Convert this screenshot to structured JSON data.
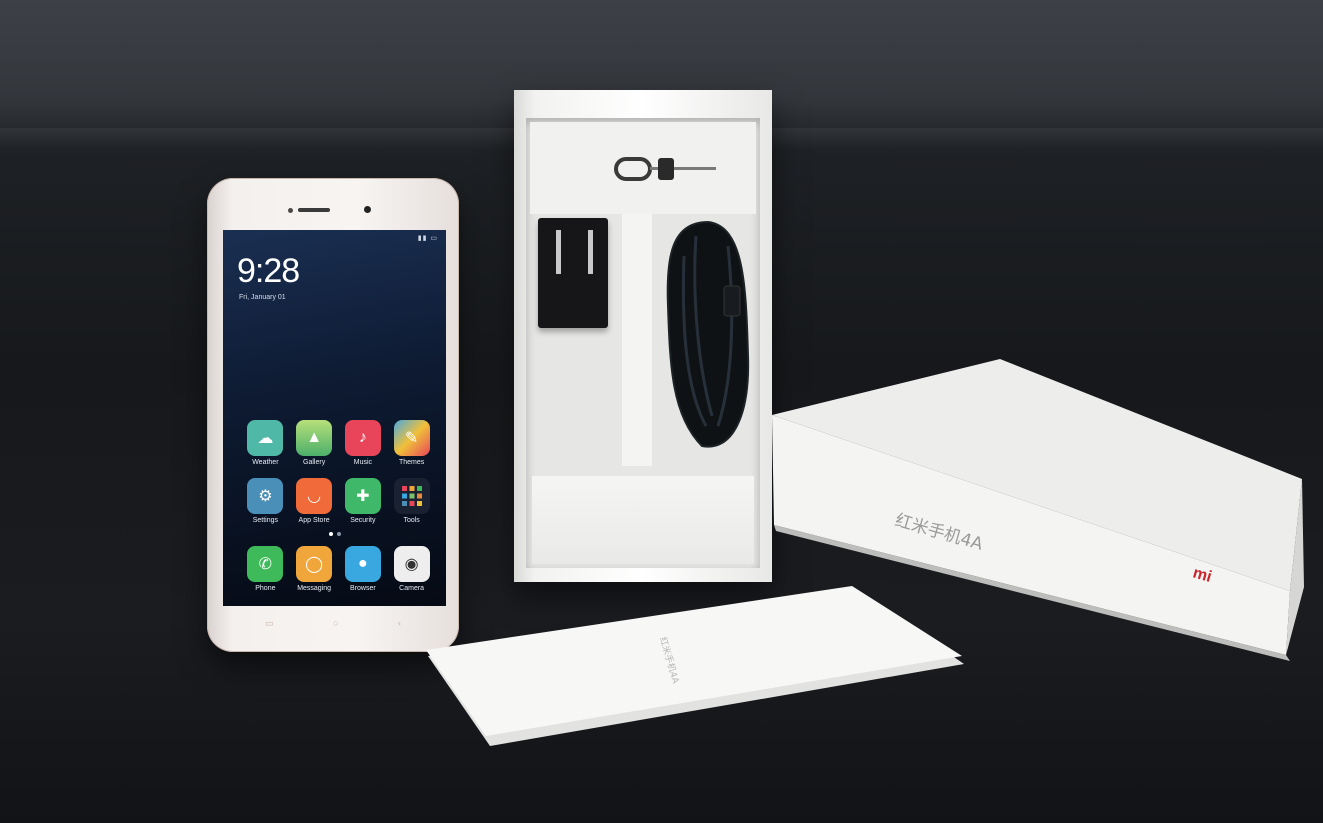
{
  "phone": {
    "clock": "9:28",
    "date": "Fri, January 01",
    "apps": [
      {
        "label": "Weather",
        "icon": "weather-icon",
        "color": "#4fb8a6"
      },
      {
        "label": "Gallery",
        "icon": "gallery-icon",
        "color": "#7cc46a"
      },
      {
        "label": "Music",
        "icon": "music-icon",
        "color": "#e8455a"
      },
      {
        "label": "Themes",
        "icon": "themes-icon",
        "color": "#e98a3a"
      },
      {
        "label": "Settings",
        "icon": "settings-icon",
        "color": "#4a8fb8"
      },
      {
        "label": "App Store",
        "icon": "app-store-icon",
        "color": "#f06a3a"
      },
      {
        "label": "Security",
        "icon": "security-icon",
        "color": "#3fb86a"
      },
      {
        "label": "Tools",
        "icon": "tools-icon",
        "color": "#2a3446"
      }
    ],
    "dock": [
      {
        "label": "Phone",
        "icon": "phone-icon",
        "color": "#3fba5a"
      },
      {
        "label": "Messaging",
        "icon": "messaging-icon",
        "color": "#f0a63a"
      },
      {
        "label": "Browser",
        "icon": "browser-icon",
        "color": "#3aa8e0"
      },
      {
        "label": "Camera",
        "icon": "camera-icon",
        "color": "#e8e8e8"
      }
    ]
  },
  "closed_box": {
    "title": "红米手机4A",
    "logo": "mi"
  },
  "leaflet": {
    "text": "红米手机4A"
  },
  "colors": {
    "phone_body": "#f4f0ee",
    "box": "#f2f2f0",
    "mi_logo": "#c8262c",
    "background": "#16181b"
  }
}
